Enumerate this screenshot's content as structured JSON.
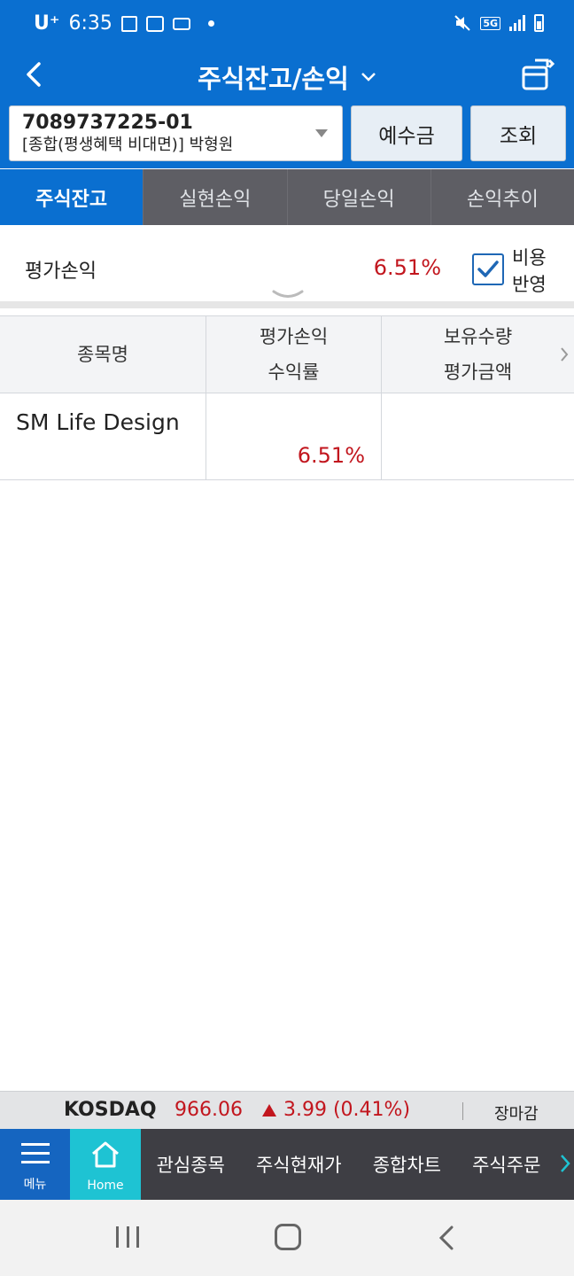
{
  "status_bar": {
    "carrier": "U⁺",
    "time": "6:35",
    "network": "5G"
  },
  "header": {
    "title": "주식잔고/손익",
    "icons": [
      "back-icon",
      "chevron-down-icon",
      "exit-icon"
    ]
  },
  "account": {
    "number": "7089737225-01",
    "description": "[종합(평생혜택 비대면)]  박형원",
    "deposit_label": "예수금",
    "query_label": "조회"
  },
  "tabs": [
    {
      "label": "주식잔고",
      "active": true
    },
    {
      "label": "실현손익",
      "active": false
    },
    {
      "label": "당일손익",
      "active": false
    },
    {
      "label": "손익추이",
      "active": false
    }
  ],
  "summary": {
    "label": "평가손익",
    "rate": "6.51%",
    "cost_label_line1": "비용",
    "cost_label_line2": "반영",
    "cost_checked": true
  },
  "table": {
    "headers": {
      "col1": "종목명",
      "col2_line1": "평가손익",
      "col2_line2": "수익률",
      "col3_line1": "보유수량",
      "col3_line2": "평가금액"
    },
    "rows": [
      {
        "name": "SM Life Design",
        "rate": "6.51%"
      }
    ]
  },
  "ticker": {
    "index_name": "KOSDAQ",
    "value": "966.06",
    "change": "3.99 (0.41%)",
    "direction": "up",
    "market_status": "장마감",
    "color_up": "#c2161e"
  },
  "bottom_nav": {
    "menu_label": "메뉴",
    "home_label": "Home",
    "items": [
      "관심종목",
      "주식현재가",
      "종합차트",
      "주식주문"
    ]
  },
  "colors": {
    "primary": "#0a6fd0",
    "tab_bar": "#5e5e64",
    "gain": "#c2161e",
    "home_accent": "#1ec3d3"
  }
}
